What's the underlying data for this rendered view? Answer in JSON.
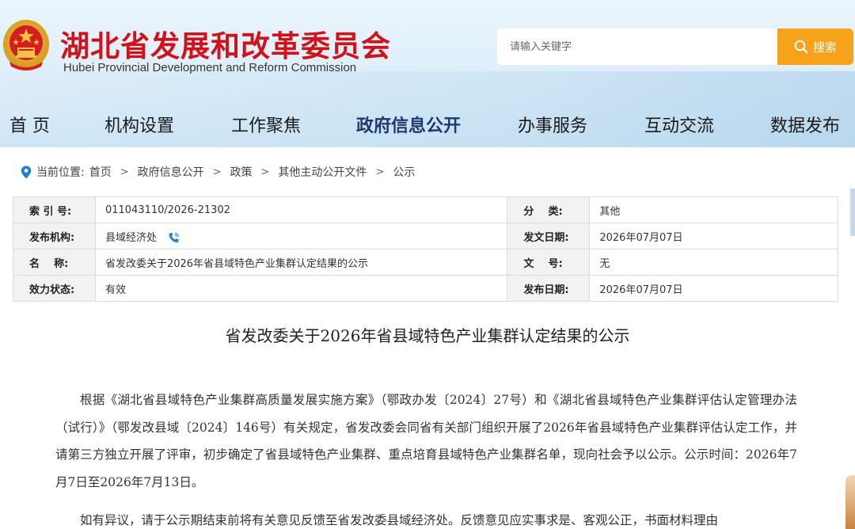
{
  "site": {
    "title": "湖北省发展和改革委员会",
    "subtitle": "Hubei Provincial Development and Reform Commission"
  },
  "search": {
    "placeholder": "请输入关键字",
    "button_label": "搜索"
  },
  "nav": {
    "items": [
      {
        "label": "首 页",
        "active": false
      },
      {
        "label": "机构设置",
        "active": false
      },
      {
        "label": "工作聚焦",
        "active": false
      },
      {
        "label": "政府信息公开",
        "active": true
      },
      {
        "label": "办事服务",
        "active": false
      },
      {
        "label": "互动交流",
        "active": false
      },
      {
        "label": "数据发布",
        "active": false
      }
    ]
  },
  "breadcrumb": {
    "prefix": "当前位置:",
    "items": [
      "首页",
      "政府信息公开",
      "政策",
      "其他主动公开文件",
      "公示"
    ],
    "separator": ">"
  },
  "info": {
    "rows": [
      {
        "l1": "索 引 号:",
        "v1": "011043110/2026-21302",
        "l2": "分    类:",
        "v2": "其他"
      },
      {
        "l1": "发布机构:",
        "v1": "县域经济处",
        "l2": "发文日期:",
        "v2": "2026年07月07日"
      },
      {
        "l1": "名    称:",
        "v1": "省发改委关于2026年省县域特色产业集群认定结果的公示",
        "l2": "文    号:",
        "v2": "无"
      },
      {
        "l1": "效力状态:",
        "v1": "有效",
        "l2": "发布日期:",
        "v2": "2026年07月07日"
      }
    ]
  },
  "document": {
    "title": "省发改委关于2026年省县域特色产业集群认定结果的公示",
    "paragraphs": [
      "根据《湖北省县域特色产业集群高质量发展实施方案》（鄂政办发〔2024〕27号）和《湖北省县域特色产业集群评估认定管理办法（试行）》（鄂发改县域〔2024〕146号）有关规定，省发改委会同省有关部门组织开展了2026年省县域特色产业集群评估认定工作，并请第三方独立开展了评审，初步确定了省县域特色产业集群、重点培育县域特色产业集群名单，现向社会予以公示。公示时间：2026年7月7日至2026年7月13日。",
      "如有异议，请于公示期结束前将有关意见反馈至省发改委县域经济处。反馈意见应实事求是、客观公正，书面材料理由"
    ]
  },
  "colors": {
    "brand_red": "#d0121b",
    "search_orange": "#f7a21b",
    "nav_active": "#1d3a6e",
    "location_blue": "#1d7fd0",
    "phone_blue": "#2a7fd6"
  },
  "icons": {
    "emblem": "national-emblem-icon",
    "search": "search-icon",
    "location": "location-pin-icon",
    "phone": "phone-icon"
  }
}
